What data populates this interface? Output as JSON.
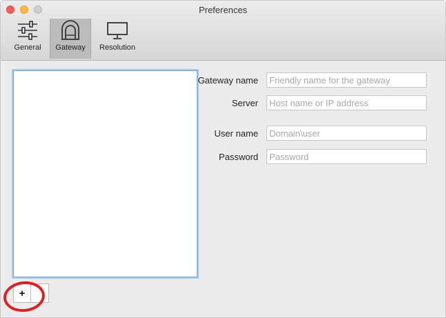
{
  "window": {
    "title": "Preferences"
  },
  "toolbar": {
    "tabs": [
      {
        "label": "General",
        "icon": "sliders-icon",
        "selected": false
      },
      {
        "label": "Gateway",
        "icon": "gateway-icon",
        "selected": true
      },
      {
        "label": "Resolution",
        "icon": "monitor-icon",
        "selected": false
      }
    ]
  },
  "form": {
    "gateway_name": {
      "label": "Gateway name",
      "value": "",
      "placeholder": "Friendly name for the gateway"
    },
    "server": {
      "label": "Server",
      "value": "",
      "placeholder": "Host name or IP address"
    },
    "user_name": {
      "label": "User name",
      "value": "",
      "placeholder": "Domain\\user"
    },
    "password": {
      "label": "Password",
      "value": "",
      "placeholder": "Password"
    }
  },
  "list": {
    "add_label": "+",
    "remove_label": ""
  },
  "colors": {
    "highlight": "#e02020",
    "selection_border": "#6aa3db"
  }
}
